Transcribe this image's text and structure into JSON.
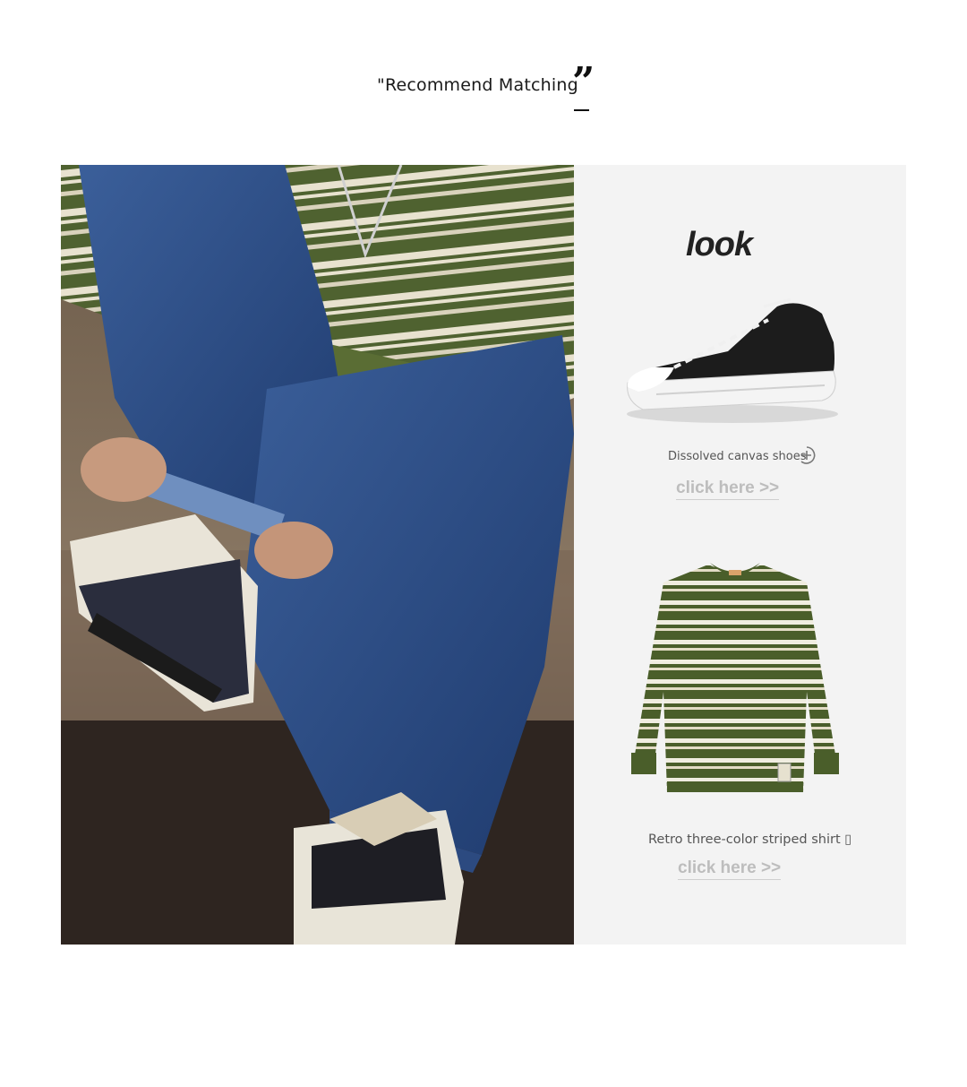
{
  "section": {
    "heading": "\"Recommend Matching",
    "quote_mark": "”"
  },
  "look_panel": {
    "title": "look",
    "items": [
      {
        "label": "Dissolved canvas shoes",
        "link": "click here >>"
      },
      {
        "label": "Retro three-color striped shirt ▯",
        "link": "click here >>"
      }
    ]
  },
  "colors": {
    "panel_bg": "#f3f3f3",
    "link": "#bdbdbd",
    "shirt_green": "#4a5e2a",
    "denim": "#2f4f86"
  }
}
